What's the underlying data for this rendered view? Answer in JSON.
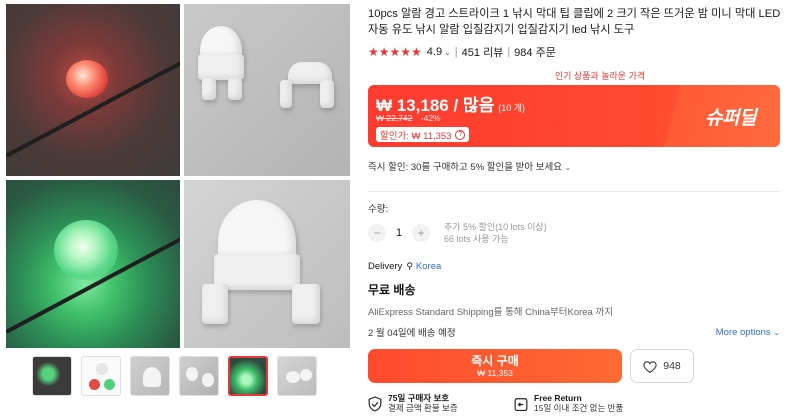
{
  "product": {
    "title": "10pcs 알람 경고 스트라이크 1 낚시 막대 팁 클립에 2 크기 작은 뜨거운 밤 미니 막대 LED 자동 유도 낚시 알람 입질감지기 입질감지기 led 낚시 도구",
    "rating": "4.9",
    "reviews": "451 리뷰",
    "orders": "984 주문"
  },
  "promo": {
    "banner": "인기 상품과 놀라운 가격",
    "price": "₩ 13,186 / 많음",
    "unit": "(10 개)",
    "original_price": "₩ 22,742",
    "discount": "-42%",
    "coupon": "할인가: ₩ 11,353",
    "super_deal": "슈퍼딜",
    "instant_discount": "즉시 할인: 30를 구매하고 5% 할인을 받아 보세요"
  },
  "quantity": {
    "label": "수량:",
    "value": "1",
    "info_line1": "추가 5% 할인(10 lots 이상)",
    "info_line2": "66 lots 사용 가능"
  },
  "delivery": {
    "label": "Delivery",
    "country": "Korea",
    "shipping_title": "무료 배송",
    "method": "AliExpress Standard Shipping를 통해 China부터Korea 까지",
    "date": "2 월 04일에 배송 예정",
    "more_options": "More options"
  },
  "actions": {
    "buy_now": "즉시 구매",
    "buy_price": "₩ 11,353",
    "wishlist_count": "948"
  },
  "guarantees": [
    {
      "title": "75일 구매자 보호",
      "subtitle": "결제 금액 환불 보증"
    },
    {
      "title": "Free Return",
      "subtitle": "15일 이내 조건 없는 반품"
    }
  ],
  "icons": {
    "wishlist": "heart-icon",
    "protection": "shield-check-icon",
    "return": "return-arrow-icon",
    "location": "pin-icon"
  },
  "colors": {
    "accent": "#ff3b30",
    "link": "#2e6fd8",
    "star": "#e53935"
  }
}
